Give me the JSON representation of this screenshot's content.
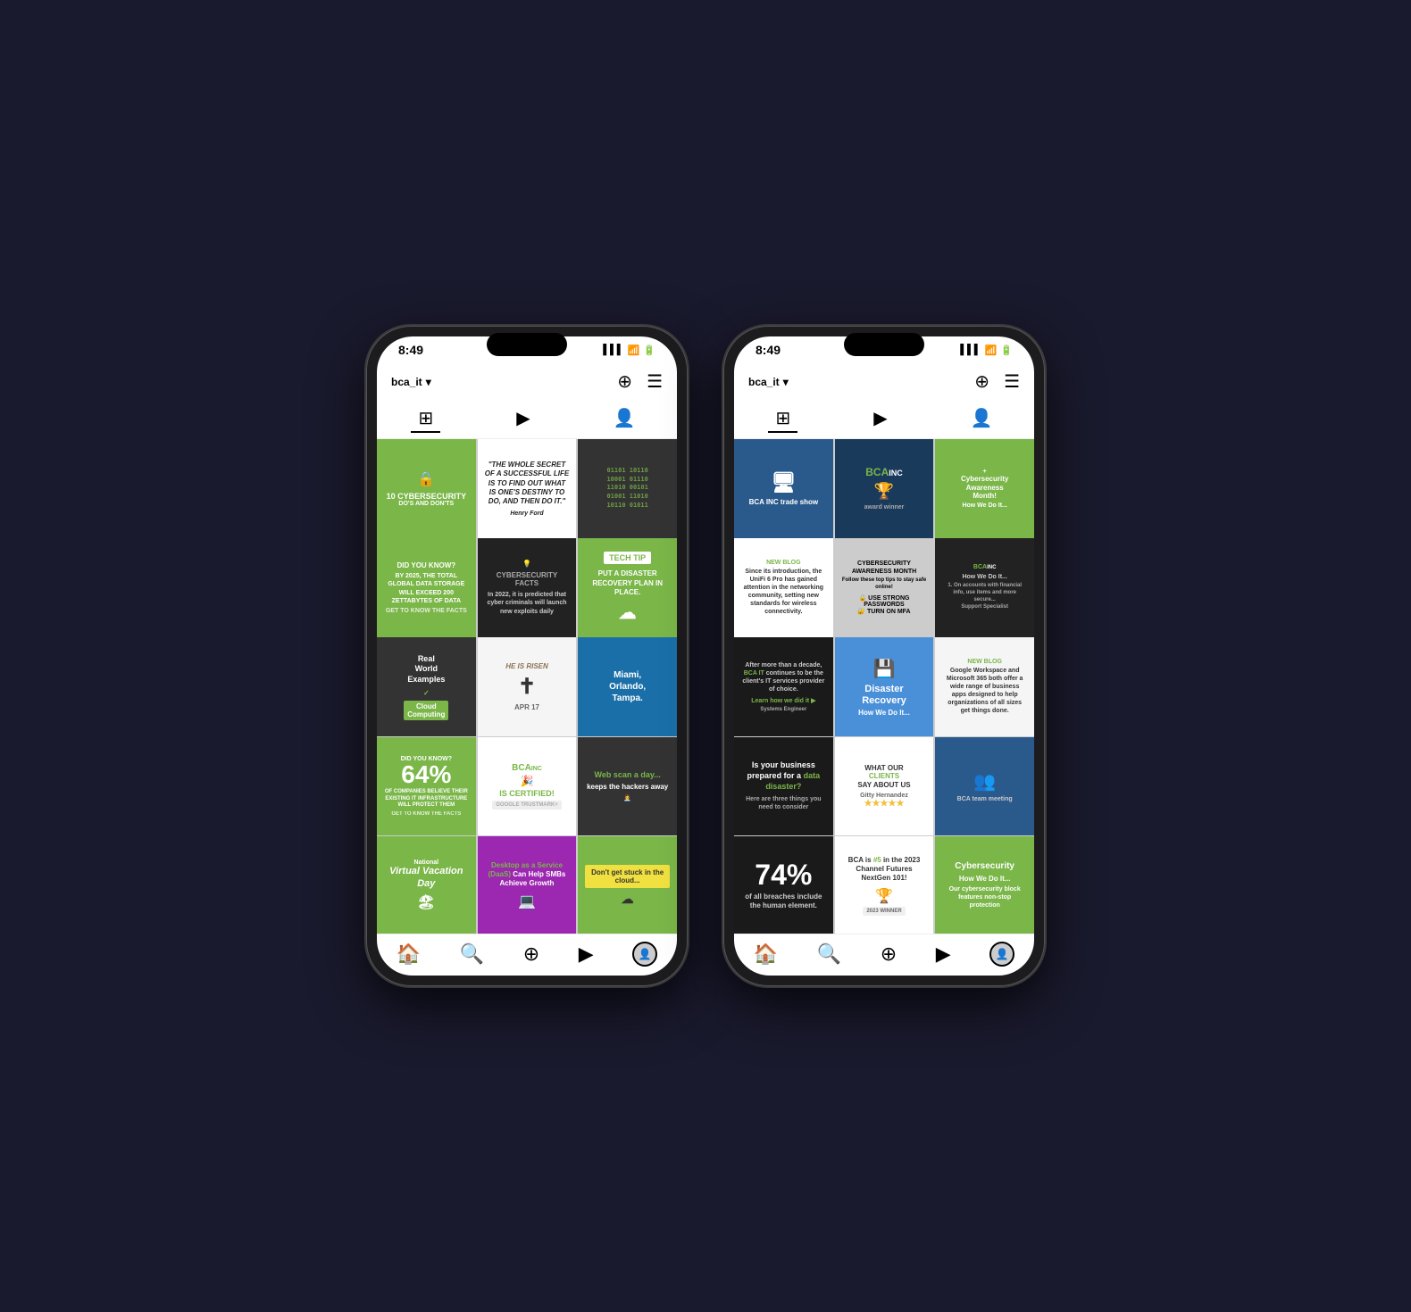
{
  "phones": [
    {
      "id": "phone1",
      "status": {
        "time": "8:49",
        "signal": "▌▌▌",
        "wifi": "WiFi",
        "battery": "27"
      },
      "header": {
        "username": "bca_it",
        "add_icon": "+",
        "menu_icon": "☰"
      },
      "nav_tabs": [
        "grid",
        "video",
        "profile"
      ],
      "grid_items": [
        {
          "id": "cyber-dos",
          "type": "cyber-dos",
          "text": "10 CYBERSECURITY DO'S AND DON'TS"
        },
        {
          "id": "henry-ford",
          "type": "henry-ford",
          "text": "THE WHOLE SECRET OF A SUCCESSFUL LIFE IS TO FIND OUT WHAT IS ONE'S DESTINY TO DO, AND THEN DO IT. — Henry Ford"
        },
        {
          "id": "numbers",
          "type": "numbers",
          "text": "encrypted data matrix"
        },
        {
          "id": "did-know-storage",
          "type": "did-know-storage",
          "text": "DID YOU KNOW? BY 2025, THE TOTAL GLOBAL DATA STORAGE WILL EXCEED 200 ZETTABYTES"
        },
        {
          "id": "cyber-facts",
          "type": "cyber-facts",
          "text": "CYBERSECURITY FACTS — In 2022, it is predicted that cyber criminals will launch new exploits daily"
        },
        {
          "id": "techtip",
          "type": "techtip",
          "text": "TECH TIP — PUT A DISASTER RECOVERY PLAN IN PLACE."
        },
        {
          "id": "real-world",
          "type": "real-world",
          "text": "Real World Examples — Cloud Computing"
        },
        {
          "id": "easter",
          "type": "easter",
          "text": "HE IS RISEN — APR 17"
        },
        {
          "id": "miami",
          "type": "miami",
          "text": "Miami, Orlando, Tampa."
        },
        {
          "id": "64pct",
          "type": "64pct",
          "text": "DID YOU KNOW? 64% OF COMPANIES BELIEVE THEIR EXISTING IT INFRASTRUCTURE WILL PROTECT THEM"
        },
        {
          "id": "certified",
          "type": "certified",
          "text": "BCA INC IS CERTIFIED! GOOGLE TRUSTMARK"
        },
        {
          "id": "web-scan",
          "type": "web-scan",
          "text": "Web scan a day... keeps the hackers away"
        },
        {
          "id": "virtual-vacation",
          "type": "virtual-vacation",
          "text": "National Virtual Vacation Day"
        },
        {
          "id": "daas",
          "type": "daas",
          "text": "Desktop as a Service (DaaS) Can Help SMBs Achieve Growth"
        },
        {
          "id": "dont-stuck",
          "type": "dont-stuck",
          "text": "Don't get stuck in the cloud..."
        }
      ],
      "bottom_nav": [
        "home",
        "search",
        "add",
        "reels",
        "profile"
      ]
    },
    {
      "id": "phone2",
      "status": {
        "time": "8:49",
        "signal": "▌▌▌",
        "wifi": "WiFi",
        "battery": "27"
      },
      "header": {
        "username": "bca_it",
        "add_icon": "+",
        "menu_icon": "☰"
      },
      "nav_tabs": [
        "grid",
        "video",
        "profile"
      ],
      "grid_items": [
        {
          "id": "trade-show",
          "type": "trade-show",
          "text": "BCA trade show booth"
        },
        {
          "id": "bca-logo",
          "type": "bca-logo",
          "text": "BCA INC — award winners"
        },
        {
          "id": "cyber-awareness-month",
          "type": "cyber-awareness-month",
          "text": "Cybersecurity Awareness Month!"
        },
        {
          "id": "blog-unifi",
          "type": "blog-unifi",
          "text": "NEW BLOG — Since its introduction, the UniFi 6 Pro has gained attention in the networking community"
        },
        {
          "id": "cyber-month2",
          "type": "cyber-month2",
          "text": "CYBERSECURITY AWARENESS MONTH — Follow these top tips to stay safe online!"
        },
        {
          "id": "cyber-how",
          "type": "cyber-how",
          "text": "How We Do It... Cybersecurity tips"
        },
        {
          "id": "decade",
          "type": "decade",
          "text": "After more than a decade, BCA IT continues to be the client's IT services provider of choice. Learn how we did it"
        },
        {
          "id": "disaster-rec",
          "type": "disaster-rec",
          "text": "Disaster Recovery — How We Do It..."
        },
        {
          "id": "google-ms",
          "type": "google-ms",
          "text": "NEW BLOG — Google Workspace and Microsoft 365 both offer a wide range of business apps"
        },
        {
          "id": "data-disaster",
          "type": "data-disaster",
          "text": "Is your business prepared for a data disaster? Here are three things you need to consider"
        },
        {
          "id": "clients",
          "type": "clients",
          "text": "WHAT OUR CLIENTS SAY ABOUT US — Gitty Hernandez"
        },
        {
          "id": "office-photo",
          "type": "office-photo",
          "text": "BCA team meeting"
        },
        {
          "id": "74pct",
          "type": "74pct",
          "text": "74% of all breaches include the human element."
        },
        {
          "id": "channel",
          "type": "channel",
          "text": "BCA is #5 in the 2023 Channel Futures NextGen 101!"
        },
        {
          "id": "cyber2",
          "type": "cyber2",
          "text": "Cybersecurity — How We Do It..."
        }
      ],
      "bottom_nav": [
        "home",
        "search",
        "add",
        "reels",
        "profile"
      ]
    }
  ]
}
